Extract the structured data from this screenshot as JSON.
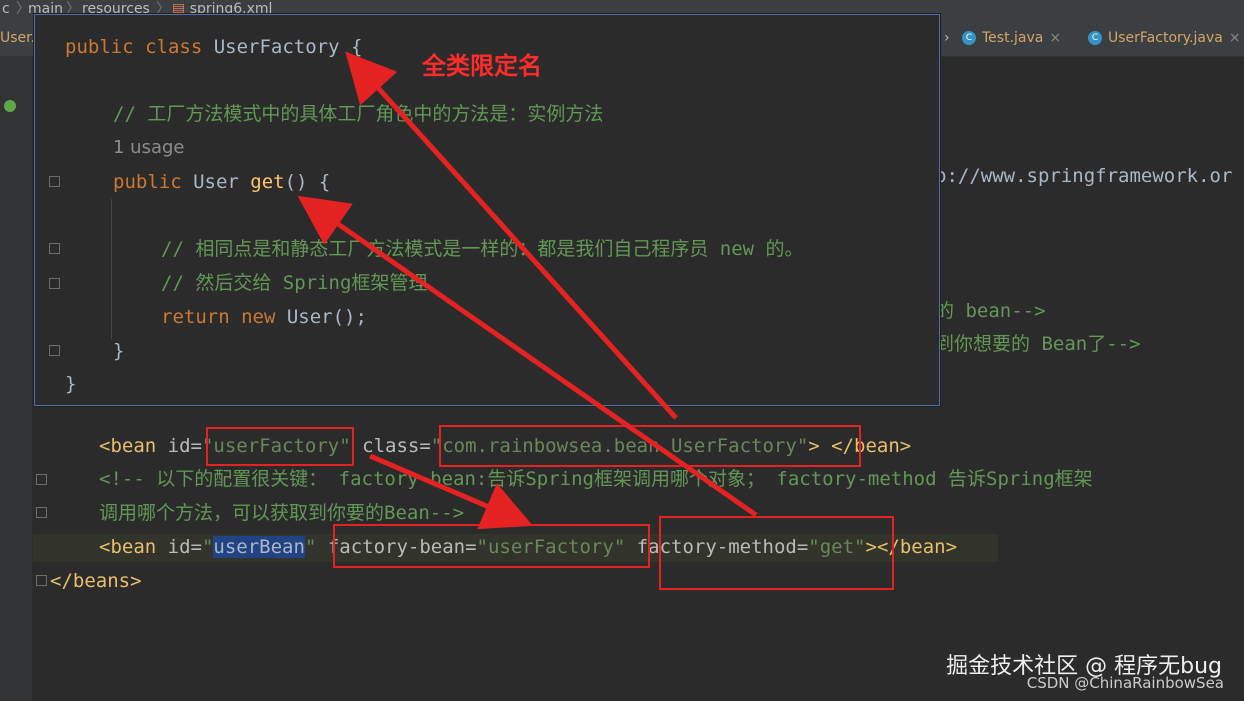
{
  "breadcrumb": {
    "c": "c",
    "main": "main",
    "resources": "resources",
    "file": "spring6.xml"
  },
  "tabs": {
    "left": "User.j",
    "test": "Test.java",
    "factory": "UserFactory.java",
    "close": "×"
  },
  "editor": {
    "right1": "p://www.springframework.or",
    "right2": "的 bean-->",
    "right3": "到你想要的 Bean了-->",
    "l1_open": "<bean",
    "l1_id_attr": " id=",
    "l1_id_val": "\"userFactory\"",
    "l1_class_attr": " class=",
    "l1_class_val": "\"com.rainbowsea.bean.UserFactory\"",
    "l1_mid": "> ",
    "l1_close": "</bean>",
    "c1": "<!--    以下的配置很关键： factory-bean:告诉Spring框架调用哪个对象； factory-method 告诉Spring框架",
    "c2": "调用哪个方法，可以获取到你要的Bean-->",
    "l2_open": "<bean",
    "l2_id_attr": " id=",
    "l2_id_val_q": "\"",
    "l2_id_val": "userBean",
    "l2_fb_attr": " factory-bean=",
    "l2_fb_val": "\"userFactory\"",
    "l2_fm_attr": " factory-method=",
    "l2_fm_val": "\"get\"",
    "l2_close": "></bean>",
    "end": "</beans>"
  },
  "popup": {
    "p1_kw": "public class ",
    "p1_name": "UserFactory",
    "p1_brace": " {",
    "p2": "// 工厂方法模式中的具体工厂角色中的方法是：实例方法",
    "usage": "1 usage",
    "p3_kw": "public ",
    "p3_type": "User ",
    "p3_fn": "get",
    "p3_rest": "() {",
    "p4": "// 相同点是和静态工厂方法模式是一样的：都是我们自己程序员 new 的。",
    "p5": "// 然后交给 Spring框架管理",
    "p6_kw1": "return ",
    "p6_kw2": "new ",
    "p6_rest": "User();",
    "p7": "}",
    "p8": "}"
  },
  "annotation": "全类限定名",
  "watermark": {
    "line1": "掘金技术社区 @ 程序无bug",
    "line2": "CSDN @ChinaRainbowSea"
  },
  "colors": {
    "accent_red": "#e52222",
    "tag": "#e8bf6a",
    "string": "#6a8759",
    "keyword": "#cc7832"
  }
}
